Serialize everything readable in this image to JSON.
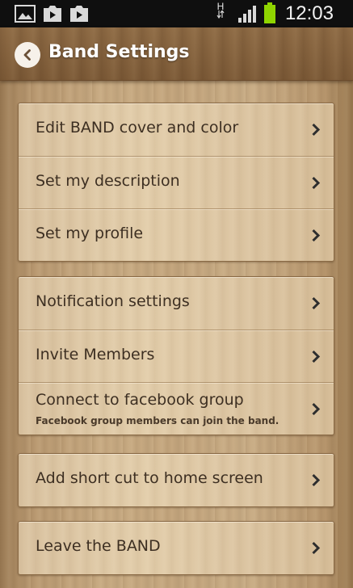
{
  "status_bar": {
    "time": "12:03",
    "network_type": "H",
    "icons": [
      "gallery-icon",
      "play-store-icon",
      "play-store-icon",
      "data-arrows-icon",
      "signal-icon",
      "battery-icon"
    ],
    "battery_color": "#8fd400"
  },
  "header": {
    "title": "Band Settings",
    "back_icon": "back-arrow-icon"
  },
  "groups": [
    {
      "items": [
        {
          "label": "Edit BAND cover and color"
        },
        {
          "label": "Set my description"
        },
        {
          "label": "Set my profile"
        }
      ]
    },
    {
      "items": [
        {
          "label": "Notification settings"
        },
        {
          "label": "Invite Members"
        },
        {
          "label": "Connect to facebook group",
          "sublabel": "Facebook group members can join the band."
        }
      ]
    },
    {
      "items": [
        {
          "label": "Add short cut to home screen"
        }
      ]
    },
    {
      "items": [
        {
          "label": "Leave the BAND"
        }
      ]
    }
  ],
  "colors": {
    "text": "#3d2f22",
    "header_text": "#ffffff",
    "chevron": "#2e2e2e"
  }
}
